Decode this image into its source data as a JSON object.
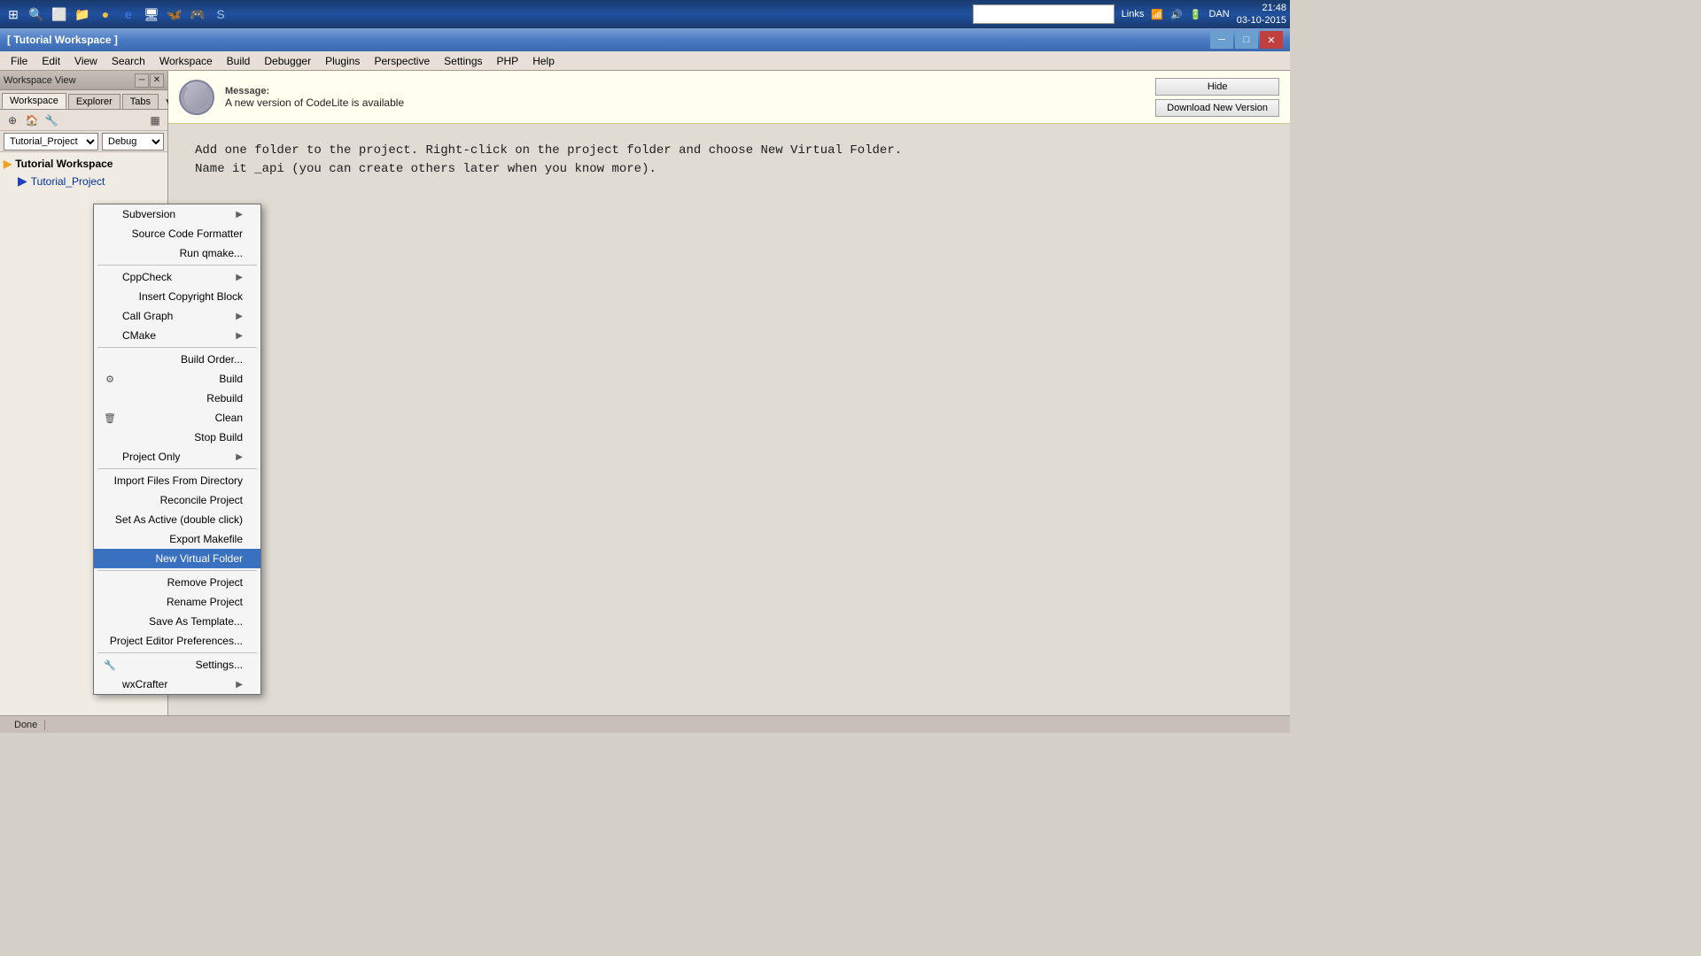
{
  "taskbar": {
    "search_placeholder": "",
    "time": "21:48",
    "date": "03-10-2015",
    "username": "DAN",
    "links_label": "Links"
  },
  "titlebar": {
    "title": "[ Tutorial Workspace ]",
    "min_btn": "─",
    "max_btn": "□",
    "close_btn": "✕"
  },
  "menubar": {
    "items": [
      "File",
      "Edit",
      "View",
      "Search",
      "Workspace",
      "Build",
      "Debugger",
      "Plugins",
      "Perspective",
      "Settings",
      "PHP",
      "Help"
    ]
  },
  "workspace_view": {
    "title": "Workspace View",
    "tabs": [
      "Workspace",
      "Explorer",
      "Tabs"
    ],
    "active_tab": "Workspace",
    "project_name": "Tutorial_Project",
    "config": "Debug"
  },
  "tree": {
    "workspace_label": "Tutorial Workspace",
    "project_label": "Tutorial_Project"
  },
  "context_menu": {
    "items": [
      {
        "label": "Subversion",
        "has_arrow": true,
        "icon": ""
      },
      {
        "label": "Source Code Formatter",
        "has_arrow": false,
        "icon": ""
      },
      {
        "label": "Run qmake...",
        "has_arrow": false,
        "icon": ""
      },
      {
        "label": "CppCheck",
        "has_arrow": true,
        "icon": ""
      },
      {
        "label": "Insert Copyright Block",
        "has_arrow": false,
        "icon": ""
      },
      {
        "label": "Call Graph",
        "has_arrow": true,
        "icon": ""
      },
      {
        "label": "CMake",
        "has_arrow": true,
        "icon": ""
      },
      {
        "label": "Build Order...",
        "has_arrow": false,
        "icon": ""
      },
      {
        "label": "Build",
        "has_arrow": false,
        "icon": "⚙",
        "is_build": true
      },
      {
        "label": "Rebuild",
        "has_arrow": false,
        "icon": ""
      },
      {
        "label": "Clean",
        "has_arrow": false,
        "icon": "🗑",
        "is_clean": true
      },
      {
        "label": "Stop Build",
        "has_arrow": false,
        "icon": ""
      },
      {
        "label": "Project Only",
        "has_arrow": true,
        "icon": ""
      },
      {
        "label": "Import Files From Directory",
        "has_arrow": false,
        "icon": ""
      },
      {
        "label": "Reconcile Project",
        "has_arrow": false,
        "icon": ""
      },
      {
        "label": "Set As Active (double click)",
        "has_arrow": false,
        "icon": ""
      },
      {
        "label": "Export Makefile",
        "has_arrow": false,
        "icon": ""
      },
      {
        "label": "New Virtual Folder",
        "has_arrow": false,
        "icon": "",
        "active": true
      },
      {
        "label": "Remove Project",
        "has_arrow": false,
        "icon": ""
      },
      {
        "label": "Rename Project",
        "has_arrow": false,
        "icon": ""
      },
      {
        "label": "Save As Template...",
        "has_arrow": false,
        "icon": ""
      },
      {
        "label": "Project Editor Preferences...",
        "has_arrow": false,
        "icon": ""
      },
      {
        "label": "Settings...",
        "has_arrow": false,
        "icon": "🔧",
        "is_settings": true
      },
      {
        "label": "wxCrafter",
        "has_arrow": true,
        "icon": ""
      }
    ]
  },
  "message": {
    "label": "Message:",
    "text": "A new version of CodeLite is available",
    "hide_btn": "Hide",
    "download_btn": "Download New Version"
  },
  "editor": {
    "line1": "Add one folder to the project. Right-click on the project folder and choose New Virtual Folder.",
    "line2": "Name it _api (you can create others later when you know more)."
  },
  "statusbar": {
    "text": "Done"
  }
}
